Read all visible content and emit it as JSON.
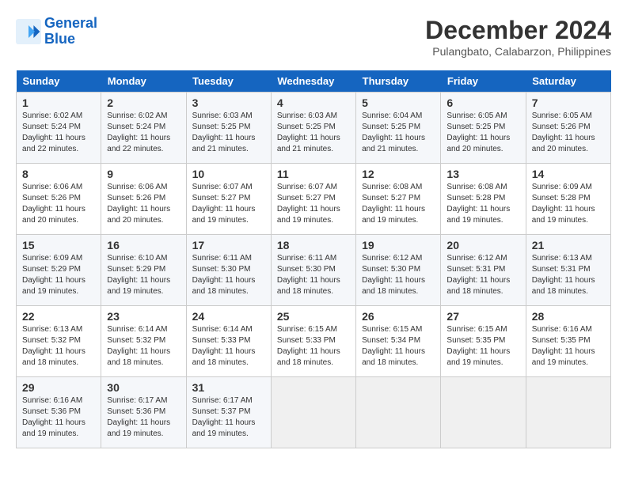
{
  "header": {
    "logo_line1": "General",
    "logo_line2": "Blue",
    "month_title": "December 2024",
    "location": "Pulangbato, Calabarzon, Philippines"
  },
  "weekdays": [
    "Sunday",
    "Monday",
    "Tuesday",
    "Wednesday",
    "Thursday",
    "Friday",
    "Saturday"
  ],
  "weeks": [
    [
      {
        "day": "1",
        "info": "Sunrise: 6:02 AM\nSunset: 5:24 PM\nDaylight: 11 hours\nand 22 minutes."
      },
      {
        "day": "2",
        "info": "Sunrise: 6:02 AM\nSunset: 5:24 PM\nDaylight: 11 hours\nand 22 minutes."
      },
      {
        "day": "3",
        "info": "Sunrise: 6:03 AM\nSunset: 5:25 PM\nDaylight: 11 hours\nand 21 minutes."
      },
      {
        "day": "4",
        "info": "Sunrise: 6:03 AM\nSunset: 5:25 PM\nDaylight: 11 hours\nand 21 minutes."
      },
      {
        "day": "5",
        "info": "Sunrise: 6:04 AM\nSunset: 5:25 PM\nDaylight: 11 hours\nand 21 minutes."
      },
      {
        "day": "6",
        "info": "Sunrise: 6:05 AM\nSunset: 5:25 PM\nDaylight: 11 hours\nand 20 minutes."
      },
      {
        "day": "7",
        "info": "Sunrise: 6:05 AM\nSunset: 5:26 PM\nDaylight: 11 hours\nand 20 minutes."
      }
    ],
    [
      {
        "day": "8",
        "info": "Sunrise: 6:06 AM\nSunset: 5:26 PM\nDaylight: 11 hours\nand 20 minutes."
      },
      {
        "day": "9",
        "info": "Sunrise: 6:06 AM\nSunset: 5:26 PM\nDaylight: 11 hours\nand 20 minutes."
      },
      {
        "day": "10",
        "info": "Sunrise: 6:07 AM\nSunset: 5:27 PM\nDaylight: 11 hours\nand 19 minutes."
      },
      {
        "day": "11",
        "info": "Sunrise: 6:07 AM\nSunset: 5:27 PM\nDaylight: 11 hours\nand 19 minutes."
      },
      {
        "day": "12",
        "info": "Sunrise: 6:08 AM\nSunset: 5:27 PM\nDaylight: 11 hours\nand 19 minutes."
      },
      {
        "day": "13",
        "info": "Sunrise: 6:08 AM\nSunset: 5:28 PM\nDaylight: 11 hours\nand 19 minutes."
      },
      {
        "day": "14",
        "info": "Sunrise: 6:09 AM\nSunset: 5:28 PM\nDaylight: 11 hours\nand 19 minutes."
      }
    ],
    [
      {
        "day": "15",
        "info": "Sunrise: 6:09 AM\nSunset: 5:29 PM\nDaylight: 11 hours\nand 19 minutes."
      },
      {
        "day": "16",
        "info": "Sunrise: 6:10 AM\nSunset: 5:29 PM\nDaylight: 11 hours\nand 19 minutes."
      },
      {
        "day": "17",
        "info": "Sunrise: 6:11 AM\nSunset: 5:30 PM\nDaylight: 11 hours\nand 18 minutes."
      },
      {
        "day": "18",
        "info": "Sunrise: 6:11 AM\nSunset: 5:30 PM\nDaylight: 11 hours\nand 18 minutes."
      },
      {
        "day": "19",
        "info": "Sunrise: 6:12 AM\nSunset: 5:30 PM\nDaylight: 11 hours\nand 18 minutes."
      },
      {
        "day": "20",
        "info": "Sunrise: 6:12 AM\nSunset: 5:31 PM\nDaylight: 11 hours\nand 18 minutes."
      },
      {
        "day": "21",
        "info": "Sunrise: 6:13 AM\nSunset: 5:31 PM\nDaylight: 11 hours\nand 18 minutes."
      }
    ],
    [
      {
        "day": "22",
        "info": "Sunrise: 6:13 AM\nSunset: 5:32 PM\nDaylight: 11 hours\nand 18 minutes."
      },
      {
        "day": "23",
        "info": "Sunrise: 6:14 AM\nSunset: 5:32 PM\nDaylight: 11 hours\nand 18 minutes."
      },
      {
        "day": "24",
        "info": "Sunrise: 6:14 AM\nSunset: 5:33 PM\nDaylight: 11 hours\nand 18 minutes."
      },
      {
        "day": "25",
        "info": "Sunrise: 6:15 AM\nSunset: 5:33 PM\nDaylight: 11 hours\nand 18 minutes."
      },
      {
        "day": "26",
        "info": "Sunrise: 6:15 AM\nSunset: 5:34 PM\nDaylight: 11 hours\nand 18 minutes."
      },
      {
        "day": "27",
        "info": "Sunrise: 6:15 AM\nSunset: 5:35 PM\nDaylight: 11 hours\nand 19 minutes."
      },
      {
        "day": "28",
        "info": "Sunrise: 6:16 AM\nSunset: 5:35 PM\nDaylight: 11 hours\nand 19 minutes."
      }
    ],
    [
      {
        "day": "29",
        "info": "Sunrise: 6:16 AM\nSunset: 5:36 PM\nDaylight: 11 hours\nand 19 minutes."
      },
      {
        "day": "30",
        "info": "Sunrise: 6:17 AM\nSunset: 5:36 PM\nDaylight: 11 hours\nand 19 minutes."
      },
      {
        "day": "31",
        "info": "Sunrise: 6:17 AM\nSunset: 5:37 PM\nDaylight: 11 hours\nand 19 minutes."
      },
      {
        "day": "",
        "info": ""
      },
      {
        "day": "",
        "info": ""
      },
      {
        "day": "",
        "info": ""
      },
      {
        "day": "",
        "info": ""
      }
    ]
  ]
}
